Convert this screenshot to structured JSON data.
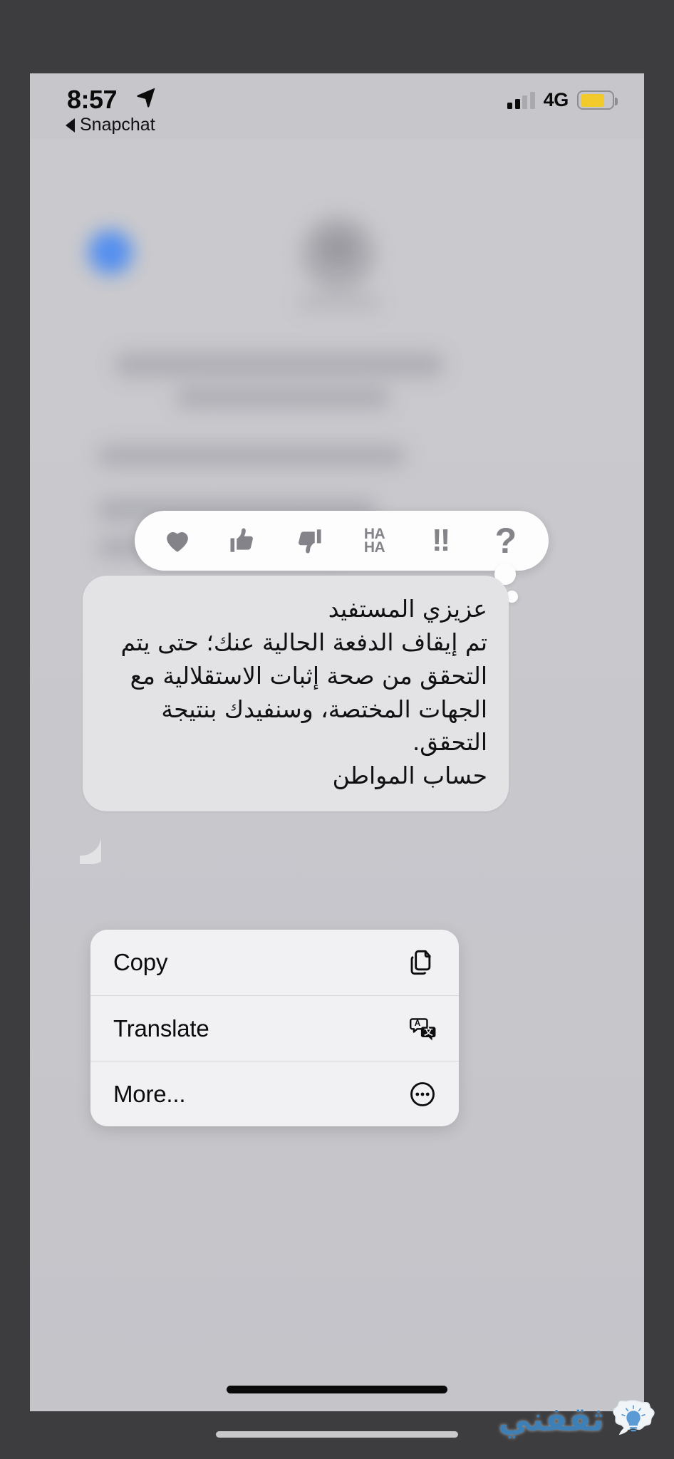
{
  "statusbar": {
    "time": "8:57",
    "location_icon": "location-arrow-icon",
    "back_app_label": "Snapchat",
    "back_chevron_icon": "back-triangle-icon",
    "signal_icon": "cellular-signal-icon",
    "signal_bars_filled": 2,
    "signal_bars_total": 4,
    "network": "4G",
    "battery_icon": "battery-icon",
    "battery_level_percent": 78,
    "battery_color": "#f2ca2c"
  },
  "reactions": {
    "items": [
      {
        "name": "heart-reaction",
        "icon": "heart-icon",
        "label": ""
      },
      {
        "name": "thumbs-up-reaction",
        "icon": "thumbs-up-icon",
        "label": ""
      },
      {
        "name": "thumbs-down-reaction",
        "icon": "thumbs-down-icon",
        "label": ""
      },
      {
        "name": "haha-reaction",
        "icon": "haha-icon",
        "label_line1": "HA",
        "label_line2": "HA"
      },
      {
        "name": "exclamation-reaction",
        "icon": "double-exclamation-icon",
        "label": "!!"
      },
      {
        "name": "question-reaction",
        "icon": "question-mark-icon",
        "label": "?"
      }
    ]
  },
  "message": {
    "sender_side": "incoming",
    "text": "عزيزي المستفيد\nتم إيقاف الدفعة الحالية عنك؛ حتى يتم التحقق من صحة إثبات الاستقلالية مع الجهات المختصة، وسنفيدك بنتيجة التحقق.\nحساب المواطن",
    "bubble_color": "#e3e3e6"
  },
  "context_menu": {
    "items": [
      {
        "label": "Copy",
        "icon": "copy-pages-icon"
      },
      {
        "label": "Translate",
        "icon": "translate-icon"
      },
      {
        "label": "More...",
        "icon": "ellipsis-circle-icon"
      }
    ]
  },
  "watermark": {
    "text": "ثقفني",
    "logo_icon": "lightbulb-speech-bubble-icon",
    "color": "#3e7fb5"
  },
  "home_indicator": {
    "inner_icon": "home-indicator",
    "outer_icon": "home-indicator"
  }
}
